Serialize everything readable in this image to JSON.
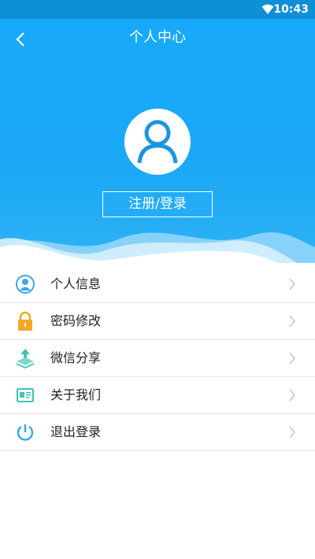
{
  "status_bar": {
    "time": "10:43",
    "wifi_icon": "wifi-icon"
  },
  "header": {
    "title": "个人中心",
    "back_icon": "back-arrow-icon",
    "avatar_icon": "user-avatar-icon",
    "login_label": "注册/登录"
  },
  "menu": {
    "items": [
      {
        "label": "个人信息",
        "icon": "person-info-icon",
        "color": "#3aa9e6"
      },
      {
        "label": "密码修改",
        "icon": "lock-icon",
        "color": "#f5a623"
      },
      {
        "label": "微信分享",
        "icon": "share-upload-icon",
        "color": "#3cc6b0"
      },
      {
        "label": "关于我们",
        "icon": "id-card-icon",
        "color": "#3cc6b0"
      },
      {
        "label": "退出登录",
        "icon": "power-icon",
        "color": "#3aa9e6"
      }
    ]
  },
  "colors": {
    "primary": "#1aa8f7",
    "status_bar": "#0f8fd6"
  }
}
